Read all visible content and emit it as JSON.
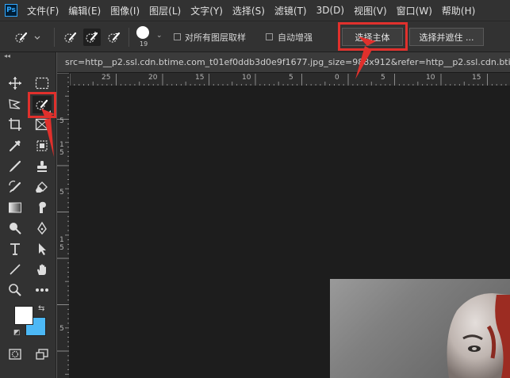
{
  "app": {
    "logo_text": "Ps"
  },
  "menu": {
    "items": [
      "文件(F)",
      "编辑(E)",
      "图像(I)",
      "图层(L)",
      "文字(Y)",
      "选择(S)",
      "滤镜(T)",
      "3D(D)",
      "视图(V)",
      "窗口(W)",
      "帮助(H)"
    ]
  },
  "options": {
    "brush_size": "19",
    "sample_all_layers": {
      "label": "对所有图层取样",
      "checked": false
    },
    "auto_enhance": {
      "label": "自动增强",
      "checked": false
    },
    "select_subject_label": "选择主体",
    "select_and_mask_label": "选择并遮住 ..."
  },
  "document": {
    "tab_title": "src=http__p2.ssl.cdn.btime.com_t01ef0ddb3d0e9f1677.jpg_size=988x912&refer=http__p2.ssl.cdn.btim"
  },
  "ruler": {
    "h_labels": [
      "25",
      "20",
      "15",
      "10",
      "5",
      "0",
      "5",
      "10",
      "15"
    ],
    "v_labels": [
      "5",
      "1",
      "5",
      "5",
      "1",
      "5",
      "5"
    ]
  },
  "colors": {
    "foreground": "#ffffff",
    "background": "#4cb8f5",
    "annotation": "#e0302c"
  },
  "icons": {
    "quick_select": "quick-selection-brush-icon",
    "move": "move-icon",
    "marquee": "rectangular-marquee-icon"
  }
}
